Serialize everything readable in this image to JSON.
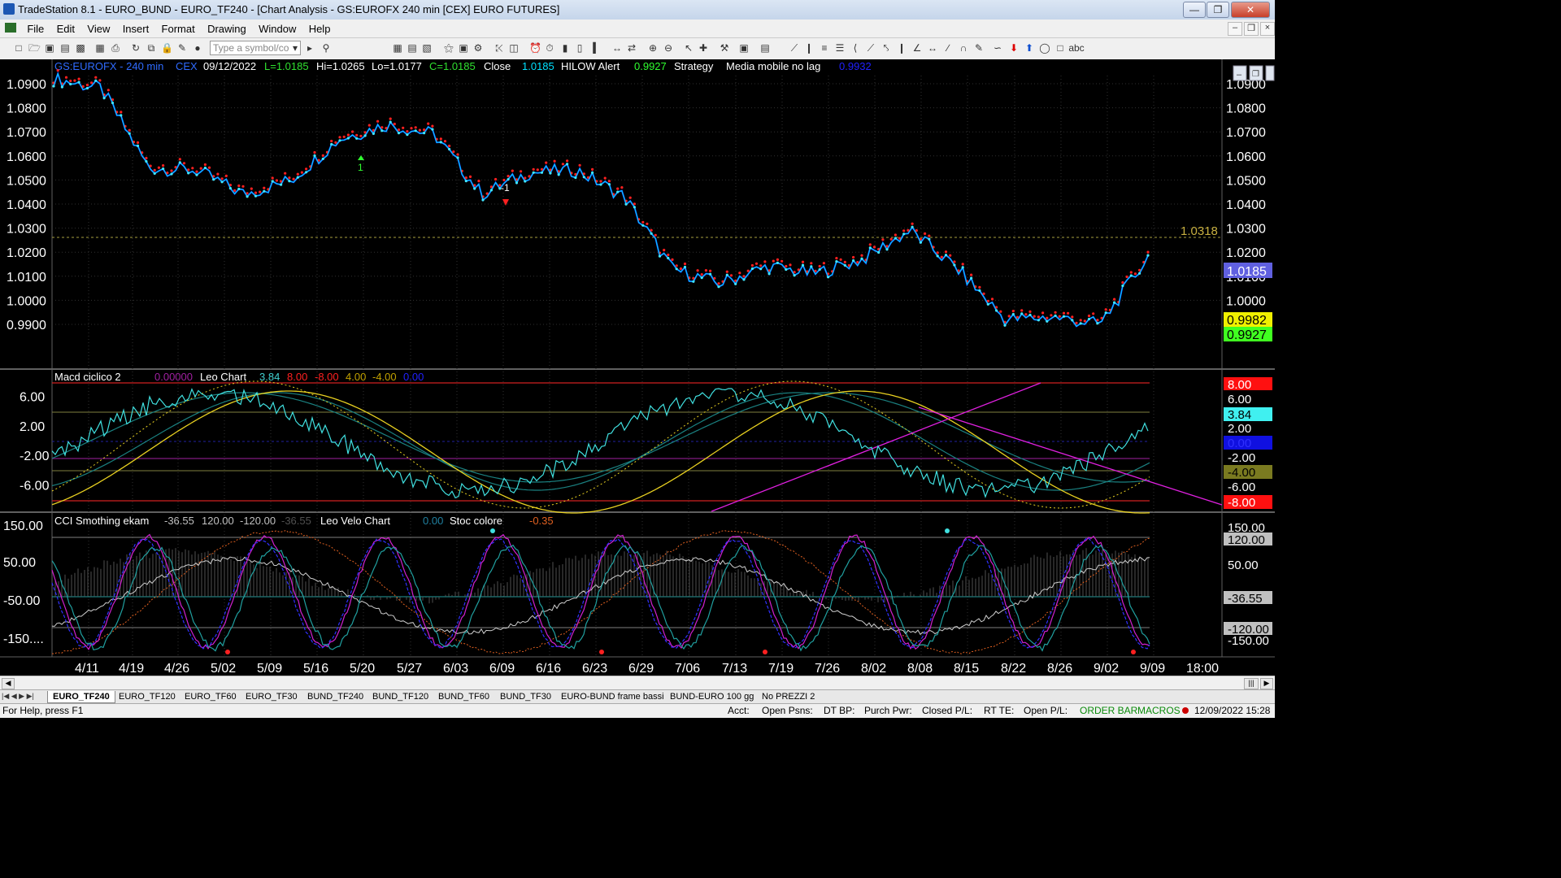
{
  "window": {
    "title": "TradeStation 8.1 - EURO_BUND - EURO_TF240 - [Chart Analysis - GS:EUROFX  240 min  [CEX] EURO FUTURES]"
  },
  "menu": [
    "File",
    "Edit",
    "View",
    "Insert",
    "Format",
    "Drawing",
    "Window",
    "Help"
  ],
  "toolbar": {
    "symbol_placeholder": "Type a symbol/co",
    "abc": "abc"
  },
  "chart_header": {
    "symbol": "GS:EUROFX - 240 min",
    "exchange": "CEX",
    "date": "09/12/2022",
    "low": "L=1.0185",
    "high": "Hi=1.0265",
    "lo": "Lo=1.0177",
    "close_val": "C=1.0185",
    "close_label": "Close",
    "close": "1.0185",
    "hilow_label": "HILOW Alert",
    "hilow": "0.9927",
    "strategy_label": "Strategy",
    "media_label": "Media mobile no lag",
    "media": "0.9932"
  },
  "colors": {
    "price": "#00e0ff",
    "red_ma": "#ff2020",
    "blue_ma": "#2020ff",
    "yellow_ma": "#e8e030",
    "green_dots": "#30ff30",
    "magenta": "#e020e0",
    "teal": "#208080",
    "grid": "#404040",
    "axis_text": "#ffffff"
  },
  "price_axis_labels": [
    "1.0900",
    "1.0800",
    "1.0700",
    "1.0600",
    "1.0500",
    "1.0400",
    "1.0300",
    "1.0200",
    "1.0100",
    "1.0000",
    "0.9900"
  ],
  "price_tags": {
    "dashed_level": "1.0318",
    "close": "1.0185",
    "yellow": "0.9982",
    "green": "0.9927"
  },
  "markers": {
    "up": "1",
    "down": "-1"
  },
  "macd_header": {
    "name": "Macd ciclico 2",
    "v0": "0.00000",
    "leo": "Leo Chart",
    "v1": "3.84",
    "v2": "8.00",
    "v3": "-8.00",
    "v4": "4.00",
    "v5": "-4.00",
    "v6": "0.00"
  },
  "macd_axis_labels": [
    "6.00",
    "2.00",
    "-2.00",
    "-6.00"
  ],
  "macd_tags": {
    "t8": "8.00",
    "t6": "6.00",
    "t384": "3.84",
    "t2": "2.00",
    "t0": "0.00",
    "tm2": "-2.00",
    "tm4": "-4.00",
    "tm6": "-6.00",
    "tm8": "-8.00"
  },
  "cci_header": {
    "name": "CCI Smothing ekam",
    "v1": "-36.55",
    "v2": "120.00",
    "v3": "-120.00",
    "v4": "-36.55",
    "velo": "Leo Velo Chart",
    "v5": "0.00",
    "stoc": "Stoc colore",
    "v6": "-0.35"
  },
  "cci_axis_labels": [
    "150.00",
    "50.00",
    "-50.00",
    "-150...."
  ],
  "cci_tags": {
    "t150": "150.00",
    "t120": "120.00",
    "t50": "50.00",
    "tm3655": "-36.55",
    "tm50": "-50.00",
    "tm120": "-120.00",
    "tm150": "-150.00"
  },
  "time_labels": [
    "4/11",
    "4/19",
    "4/26",
    "5/02",
    "5/09",
    "5/16",
    "5/20",
    "5/27",
    "6/03",
    "6/09",
    "6/16",
    "6/23",
    "6/29",
    "7/06",
    "7/13",
    "7/19",
    "7/26",
    "8/02",
    "8/08",
    "8/15",
    "8/22",
    "8/26",
    "9/02",
    "9/09",
    "18:00"
  ],
  "chart_data": {
    "type": "line",
    "x_labels": [
      "4/11",
      "4/19",
      "4/26",
      "5/02",
      "5/09",
      "5/16",
      "5/20",
      "5/27",
      "6/03",
      "6/09",
      "6/16",
      "6/23",
      "6/29",
      "7/06",
      "7/13",
      "7/19",
      "7/26",
      "8/02",
      "8/08",
      "8/15",
      "8/22",
      "8/26",
      "9/02",
      "9/09"
    ],
    "price_series": [
      1.092,
      1.088,
      1.055,
      1.054,
      1.044,
      1.05,
      1.067,
      1.073,
      1.069,
      1.044,
      1.053,
      1.054,
      1.043,
      1.013,
      1.007,
      1.014,
      1.011,
      1.017,
      1.029,
      1.013,
      0.992,
      0.993,
      0.99,
      1.018
    ],
    "ylim": [
      0.984,
      1.097
    ]
  },
  "tabs": [
    "EURO_TF240",
    "EURO_TF120",
    "EURO_TF60",
    "EURO_TF30",
    "BUND_TF240",
    "BUND_TF120",
    "BUND_TF60",
    "BUND_TF30",
    "EURO-BUND frame bassi",
    "BUND-EURO 100 gg",
    "No PREZZI 2"
  ],
  "status": {
    "help": "For Help, press F1",
    "acct": "Acct:",
    "psns": "Open Psns:",
    "dtbp": "DT BP:",
    "purch": "Purch Pwr:",
    "closedpl": "Closed P/L:",
    "rtte": "RT TE:",
    "openpl": "Open P/L:",
    "orderbar": "ORDER BAR",
    "macros": "MACROS",
    "datetime": "12/09/2022 15:28"
  }
}
